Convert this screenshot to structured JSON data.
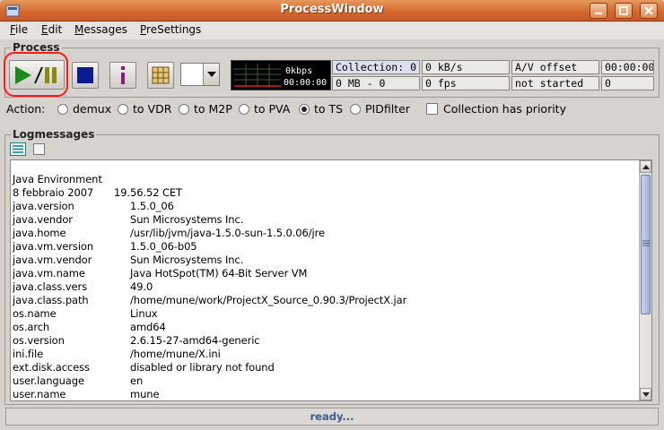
{
  "window": {
    "title": "ProcessWindow"
  },
  "menu": {
    "items": [
      {
        "label": "File"
      },
      {
        "label": "Edit"
      },
      {
        "label": "Messages"
      },
      {
        "label": "PreSettings"
      }
    ]
  },
  "process": {
    "group_label": "Process",
    "monitor": {
      "rate": "0kbps",
      "time": "00:00:00"
    },
    "status": {
      "collection": "Collection: 0",
      "rate_kb": "0 kB/s",
      "av_offset_label": "A/V offset",
      "av_offset_time": "00:00:00",
      "mb": "0 MB - 0",
      "fps": "0 fps",
      "state": "not started",
      "count": "0"
    }
  },
  "action": {
    "label": "Action:",
    "options": [
      {
        "label": "demux",
        "selected": false
      },
      {
        "label": "to VDR",
        "selected": false
      },
      {
        "label": "to M2P",
        "selected": false
      },
      {
        "label": "to PVA",
        "selected": false
      },
      {
        "label": "to TS",
        "selected": true
      },
      {
        "label": "PIDfilter",
        "selected": false
      }
    ],
    "collection_priority": {
      "label": "Collection has priority",
      "checked": false
    }
  },
  "log": {
    "group_label": "Logmessages",
    "lines": [
      {
        "key": "Java Environment",
        "value": ""
      },
      {
        "key": "8 febbraio 2007",
        "value": "19.56.52 CET",
        "value_offset": "narrow"
      },
      {
        "key": "java.version",
        "value": "1.5.0_06"
      },
      {
        "key": "java.vendor",
        "value": "Sun Microsystems Inc."
      },
      {
        "key": "java.home",
        "value": "/usr/lib/jvm/java-1.5.0-sun-1.5.0.06/jre"
      },
      {
        "key": "java.vm.version",
        "value": "1.5.0_06-b05"
      },
      {
        "key": "java.vm.vendor",
        "value": "Sun Microsystems Inc."
      },
      {
        "key": "java.vm.name",
        "value": "Java HotSpot(TM) 64-Bit Server VM"
      },
      {
        "key": "java.class.vers",
        "value": "49.0"
      },
      {
        "key": "java.class.path",
        "value": "/home/mune/work/ProjectX_Source_0.90.3/ProjectX.jar"
      },
      {
        "key": "os.name",
        "value": "Linux"
      },
      {
        "key": "os.arch",
        "value": "amd64"
      },
      {
        "key": "os.version",
        "value": "2.6.15-27-amd64-generic"
      },
      {
        "key": "ini.file",
        "value": "/home/mune/X.ini"
      },
      {
        "key": "ext.disk.access",
        "value": "disabled or library not found"
      },
      {
        "key": "user.language",
        "value": "en"
      },
      {
        "key": "user.name",
        "value": "mune"
      }
    ]
  },
  "statusbar": {
    "text": "ready..."
  },
  "colors": {
    "titlebar": "#d4692f",
    "play": "#1a8a1a",
    "pause": "#8a8a10",
    "stop": "#0a1a8f",
    "info": "#8b1a8b",
    "highlight_circle": "#ff1a1a",
    "status_text": "#3c5a95"
  }
}
